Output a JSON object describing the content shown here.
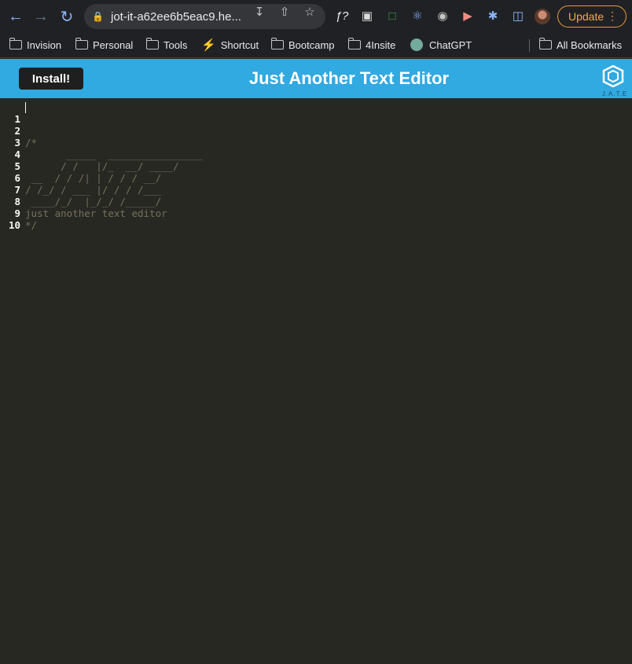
{
  "browser": {
    "url": "jot-it-a62ee6b5eac9.he...",
    "update_label": "Update",
    "nav_icons": [
      "back-icon",
      "forward-icon",
      "reload-icon"
    ],
    "extensions": [
      "formula-icon",
      "r-extension-icon",
      "screenshot-icon",
      "react-devtools-icon",
      "camera-icon",
      "video-icon",
      "puzzle-icon",
      "side-panel-icon"
    ]
  },
  "bookmarks": [
    {
      "label": "Invision",
      "icon": "folder-icon"
    },
    {
      "label": "Personal",
      "icon": "folder-icon"
    },
    {
      "label": "Tools",
      "icon": "folder-icon"
    },
    {
      "label": "Shortcut",
      "icon": "shortcut-icon"
    },
    {
      "label": "Bootcamp",
      "icon": "folder-icon"
    },
    {
      "label": "4Insite",
      "icon": "folder-icon"
    },
    {
      "label": "ChatGPT",
      "icon": "chatgpt-icon"
    },
    {
      "label": "All Bookmarks",
      "icon": "folder-icon"
    }
  ],
  "app": {
    "install_label": "Install!",
    "title": "Just Another Text Editor",
    "logo_text": "J.A.T.E",
    "header_color": "#31a9e1"
  },
  "editor": {
    "background": "#272822",
    "lines": [
      {
        "num": "1",
        "text": ""
      },
      {
        "num": "2",
        "text": "/*"
      },
      {
        "num": "3",
        "text": "       _____  ________________"
      },
      {
        "num": "4",
        "text": "      / /   |/_  __/ ____/"
      },
      {
        "num": "5",
        "text": " __  / / /| | / / / __/"
      },
      {
        "num": "6",
        "text": "/ /_/ / ___ |/ / / /___"
      },
      {
        "num": "7",
        "text": " ____/_/  |_/_/ /_____/"
      },
      {
        "num": "8",
        "text": "just another text editor"
      },
      {
        "num": "9",
        "text": "*/"
      },
      {
        "num": "10",
        "text": ""
      }
    ]
  }
}
